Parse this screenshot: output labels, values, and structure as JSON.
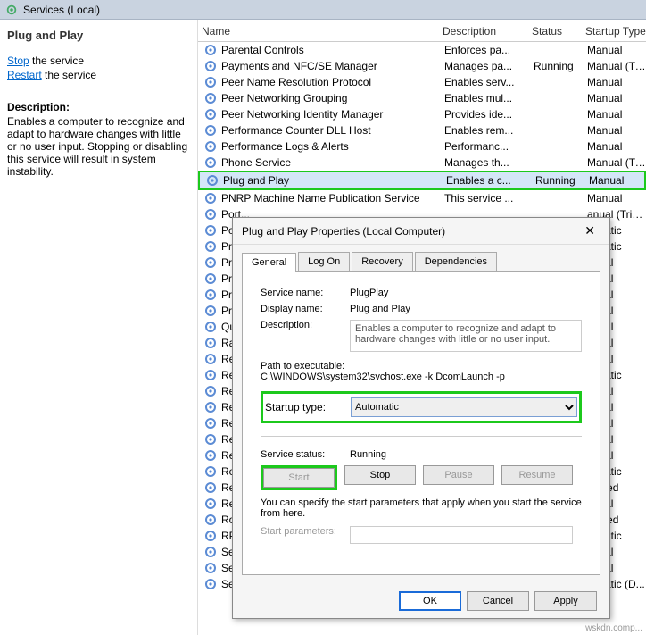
{
  "titlebar": {
    "title": "Services (Local)"
  },
  "left": {
    "heading": "Plug and Play",
    "stop_label": "Stop",
    "stop_suffix": " the service",
    "restart_label": "Restart",
    "restart_suffix": " the service",
    "desc_heading": "Description:",
    "desc_text": "Enables a computer to recognize and adapt to hardware changes with little or no user input. Stopping or disabling this service will result in system instability."
  },
  "cols": {
    "name": "Name",
    "desc": "Description",
    "status": "Status",
    "type": "Startup Type"
  },
  "services": [
    {
      "name": "Parental Controls",
      "desc": "Enforces pa...",
      "status": "",
      "type": "Manual"
    },
    {
      "name": "Payments and NFC/SE Manager",
      "desc": "Manages pa...",
      "status": "Running",
      "type": "Manual (Trig..."
    },
    {
      "name": "Peer Name Resolution Protocol",
      "desc": "Enables serv...",
      "status": "",
      "type": "Manual"
    },
    {
      "name": "Peer Networking Grouping",
      "desc": "Enables mul...",
      "status": "",
      "type": "Manual"
    },
    {
      "name": "Peer Networking Identity Manager",
      "desc": "Provides ide...",
      "status": "",
      "type": "Manual"
    },
    {
      "name": "Performance Counter DLL Host",
      "desc": "Enables rem...",
      "status": "",
      "type": "Manual"
    },
    {
      "name": "Performance Logs & Alerts",
      "desc": "Performanc...",
      "status": "",
      "type": "Manual"
    },
    {
      "name": "Phone Service",
      "desc": "Manages th...",
      "status": "",
      "type": "Manual (Trig..."
    },
    {
      "name": "Plug and Play",
      "desc": "Enables a c...",
      "status": "Running",
      "type": "Manual",
      "selected": true
    },
    {
      "name": "PNRP Machine Name Publication Service",
      "desc": "This service ...",
      "status": "",
      "type": "Manual"
    },
    {
      "name": "Port...",
      "desc": "",
      "status": "",
      "type": "anual (Trig..."
    },
    {
      "name": "Pow...",
      "desc": "",
      "status": "",
      "type": "tomatic"
    },
    {
      "name": "Print...",
      "desc": "",
      "status": "",
      "type": "tomatic"
    },
    {
      "name": "Print...",
      "desc": "",
      "status": "",
      "type": "anual"
    },
    {
      "name": "Prin...",
      "desc": "",
      "status": "",
      "type": "anual"
    },
    {
      "name": "Prob...",
      "desc": "",
      "status": "",
      "type": "anual"
    },
    {
      "name": "Prog...",
      "desc": "",
      "status": "",
      "type": "anual"
    },
    {
      "name": "Qua...",
      "desc": "",
      "status": "",
      "type": "anual"
    },
    {
      "name": "Radi...",
      "desc": "",
      "status": "",
      "type": "anual"
    },
    {
      "name": "Rec...",
      "desc": "",
      "status": "",
      "type": "anual"
    },
    {
      "name": "Rem...",
      "desc": "",
      "status": "",
      "type": "tomatic"
    },
    {
      "name": "Rem...",
      "desc": "",
      "status": "",
      "type": "anual"
    },
    {
      "name": "Rem...",
      "desc": "",
      "status": "",
      "type": "anual"
    },
    {
      "name": "Rem...",
      "desc": "",
      "status": "",
      "type": "anual"
    },
    {
      "name": "Rem...",
      "desc": "",
      "status": "",
      "type": "anual"
    },
    {
      "name": "Rem...",
      "desc": "",
      "status": "",
      "type": "anual"
    },
    {
      "name": "Rem...",
      "desc": "",
      "status": "",
      "type": "tomatic"
    },
    {
      "name": "Rem...",
      "desc": "",
      "status": "",
      "type": "sabled"
    },
    {
      "name": "Reta...",
      "desc": "",
      "status": "",
      "type": "anual"
    },
    {
      "name": "Rou...",
      "desc": "",
      "status": "",
      "type": "sabled"
    },
    {
      "name": "RPC...",
      "desc": "",
      "status": "",
      "type": "tomatic"
    },
    {
      "name": "Sec...",
      "desc": "",
      "status": "",
      "type": "anual"
    },
    {
      "name": "Sec...",
      "desc": "",
      "status": "",
      "type": "anual"
    },
    {
      "name": "Secu...",
      "desc": "",
      "status": "",
      "type": "tomatic (D..."
    }
  ],
  "dialog": {
    "title": "Plug and Play Properties (Local Computer)",
    "tabs": {
      "general": "General",
      "logon": "Log On",
      "recovery": "Recovery",
      "deps": "Dependencies"
    },
    "svc_name_lab": "Service name:",
    "svc_name": "PlugPlay",
    "disp_lab": "Display name:",
    "disp_val": "Plug and Play",
    "desc_lab": "Description:",
    "desc_val": "Enables a computer to recognize and adapt to hardware changes with little or no user input.",
    "path_lab": "Path to executable:",
    "path_val": "C:\\WINDOWS\\system32\\svchost.exe -k DcomLaunch -p",
    "startup_lab": "Startup type:",
    "startup_val": "Automatic",
    "status_lab": "Service status:",
    "status_val": "Running",
    "btn_start": "Start",
    "btn_stop": "Stop",
    "btn_pause": "Pause",
    "btn_resume": "Resume",
    "param_note": "You can specify the start parameters that apply when you start the service from here.",
    "param_lab": "Start parameters:",
    "ok": "OK",
    "cancel": "Cancel",
    "apply": "Apply"
  },
  "footer": "wskdn.comp..."
}
